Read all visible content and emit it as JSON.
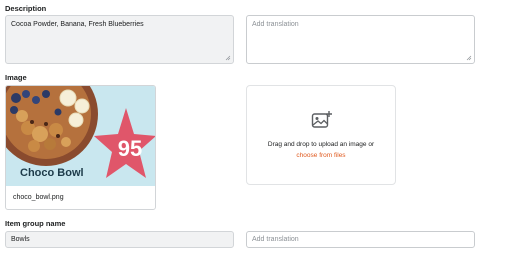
{
  "description": {
    "label": "Description",
    "value": "Cocoa Powder, Banana, Fresh Blueberries",
    "translation_placeholder": "Add translation"
  },
  "image": {
    "label": "Image",
    "filename": "choco_bowl.png",
    "product_name": "Choco Bowl",
    "badge_number": "95",
    "upload_text": "Drag and drop to upload an image or",
    "upload_link": "choose from files",
    "colors": {
      "background": "#c9e7ef",
      "star": "#e0566a",
      "bowl": "#8a4b2e",
      "link": "#e05a1f"
    }
  },
  "item_group": {
    "label": "Item group name",
    "value": "Bowls",
    "translation_placeholder": "Add translation"
  }
}
